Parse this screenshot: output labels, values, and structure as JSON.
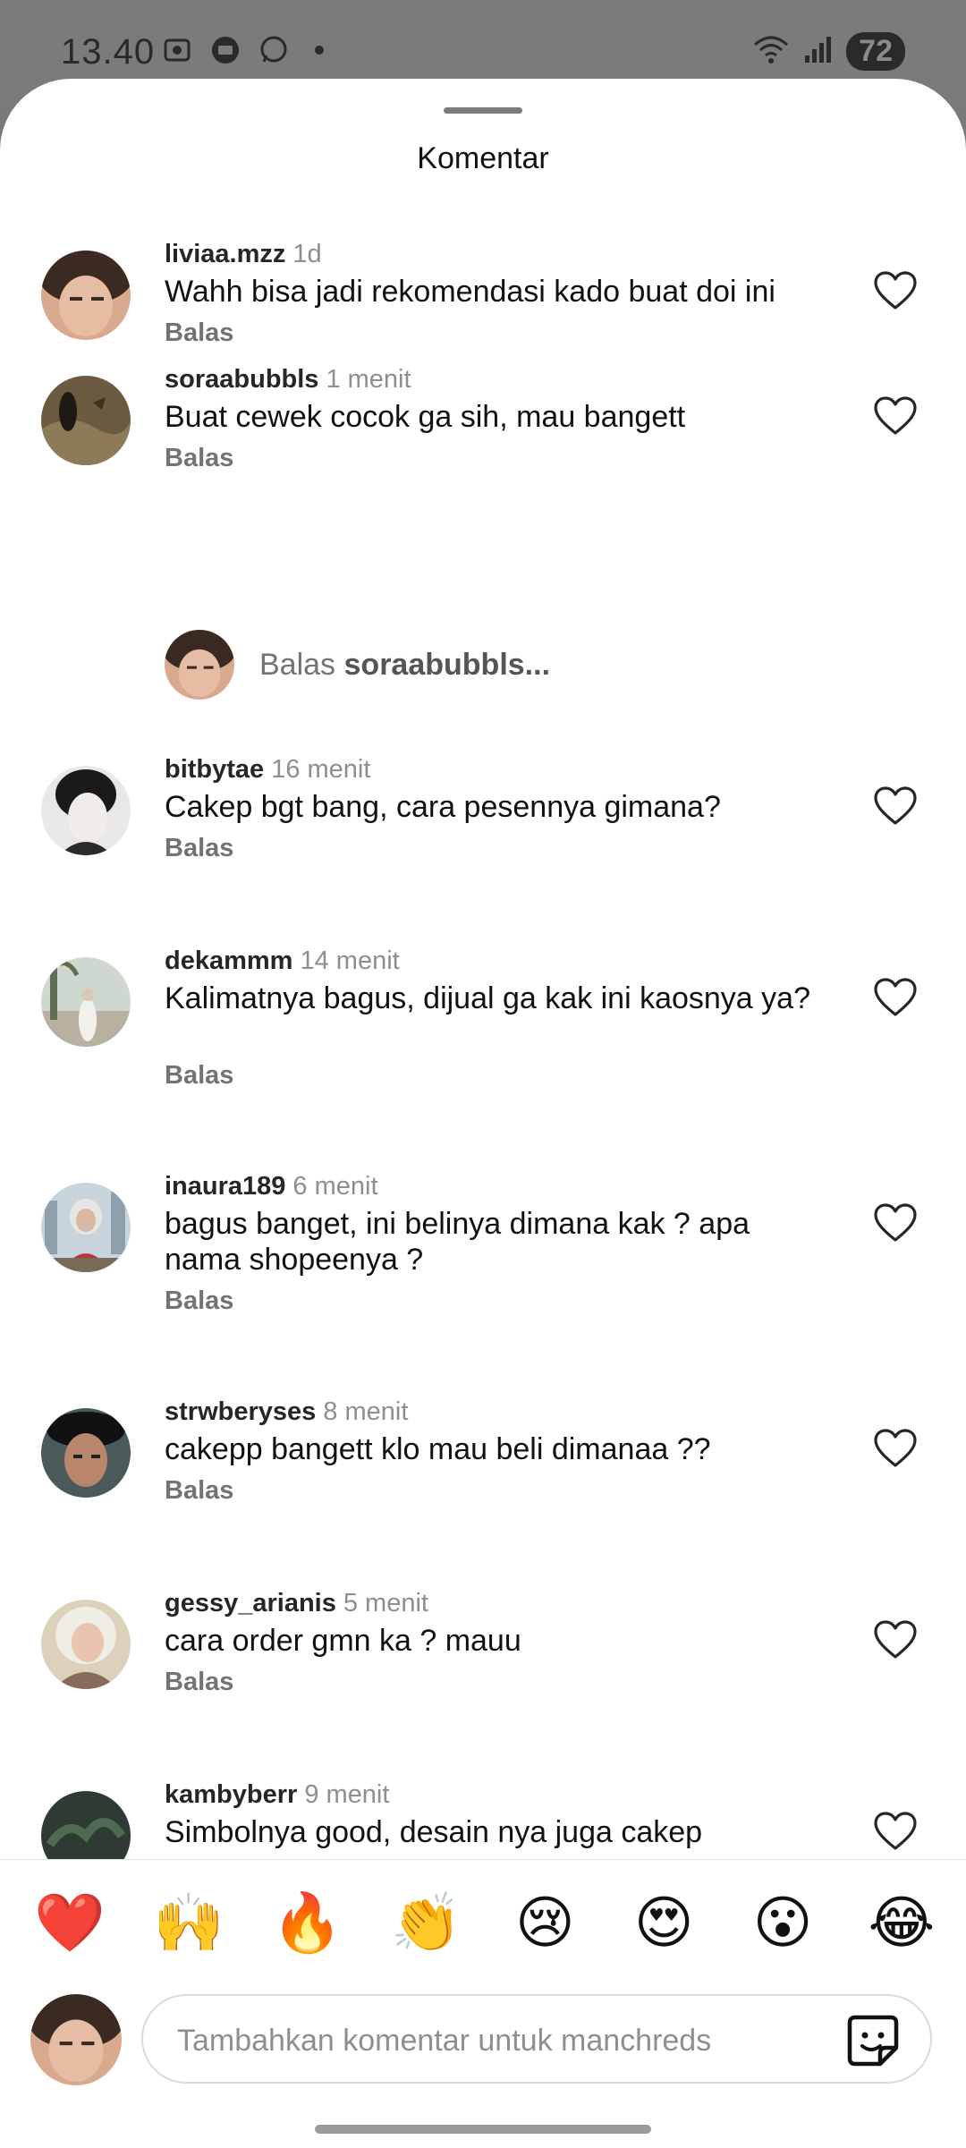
{
  "status_bar": {
    "time": "13.40",
    "battery": "72"
  },
  "sheet": {
    "title": "Komentar"
  },
  "comments": [
    {
      "user": "liviaa.mzz",
      "time": "1d",
      "text": "Wahh bisa jadi rekomendasi kado buat doi ini",
      "reply": "Balas"
    },
    {
      "user": "soraabubbls",
      "time": "1 menit",
      "text": "Buat cewek cocok ga sih, mau bangett",
      "reply": "Balas"
    },
    {
      "user": "bitbytae",
      "time": "16 menit",
      "text": "Cakep bgt bang, cara pesennya gimana?",
      "reply": "Balas"
    },
    {
      "user": "dekammm",
      "time": "14 menit",
      "text": "Kalimatnya bagus, dijual ga kak ini kaosnya ya?",
      "reply": "Balas"
    },
    {
      "user": "inaura189",
      "time": "6 menit",
      "text": "bagus banget, ini belinya dimana kak ? apa nama shopeenya ?",
      "reply": "Balas"
    },
    {
      "user": "strwberyses",
      "time": "8 menit",
      "text": "cakepp bangett klo mau beli dimanaa ??",
      "reply": "Balas"
    },
    {
      "user": "gessy_arianis",
      "time": "5 menit",
      "text": "cara order gmn ka ? mauu",
      "reply": "Balas"
    },
    {
      "user": "kambyberr",
      "time": "9 menit",
      "text": "Simbolnya good, desain nya juga cakep",
      "reply": ""
    }
  ],
  "reply_prompt": {
    "prefix": "Balas",
    "user": "soraabubbls..."
  },
  "emojis": [
    "❤️",
    "🙌",
    "🔥",
    "👏",
    "😢",
    "😍",
    "😮",
    "😂"
  ],
  "composer": {
    "placeholder": "Tambahkan komentar untuk manchreds"
  },
  "icons": {
    "heart": "heart-outline-icon",
    "sticker": "sticker-icon"
  }
}
